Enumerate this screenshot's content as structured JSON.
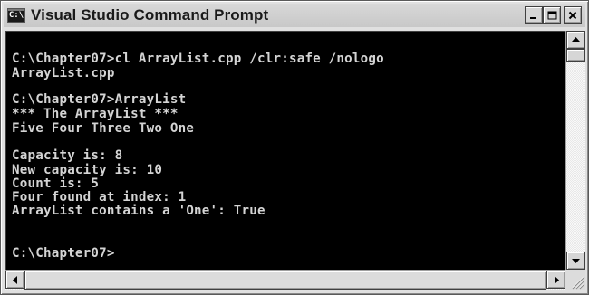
{
  "window": {
    "title": "Visual Studio Command Prompt",
    "icon_label": "C:\\"
  },
  "title_controls": {
    "minimize_icon": "minimize-icon",
    "maximize_icon": "maximize-icon",
    "close_icon": "close-icon"
  },
  "console": {
    "lines": [
      "C:\\Chapter07>cl ArrayList.cpp /clr:safe /nologo",
      "ArrayList.cpp",
      "",
      "C:\\Chapter07>ArrayList",
      "*** The ArrayList ***",
      "Five Four Three Two One",
      "",
      "Capacity is: 8",
      "New capacity is: 10",
      "Count is: 5",
      "Four found at index: 1",
      "ArrayList contains a 'One': True",
      "",
      "",
      "C:\\Chapter07>"
    ]
  },
  "colors": {
    "console_bg": "#000000",
    "console_text": "#d4d4d4",
    "chrome": "#d6d6d6"
  }
}
